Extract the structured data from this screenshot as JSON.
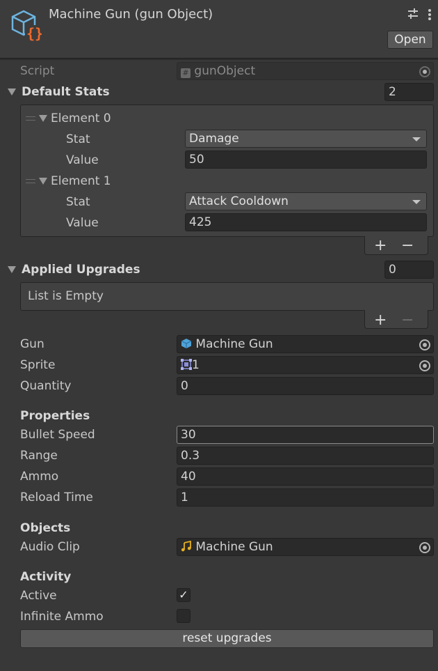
{
  "header": {
    "title": "Machine Gun (gun Object)",
    "open_label": "Open",
    "icon": "scriptable-object-icon",
    "menu_icons": [
      "settings-sliders-icon",
      "kebab-menu-icon"
    ]
  },
  "script": {
    "label": "Script",
    "value": "gunObject",
    "icon": "csharp-script-icon"
  },
  "default_stats": {
    "label": "Default Stats",
    "count": "2",
    "elements": [
      {
        "label": "Element 0",
        "stat_label": "Stat",
        "stat_value": "Damage",
        "value_label": "Value",
        "value": "50"
      },
      {
        "label": "Element 1",
        "stat_label": "Stat",
        "stat_value": "Attack Cooldown",
        "value_label": "Value",
        "value": "425"
      }
    ],
    "add": "+",
    "remove": "−"
  },
  "applied_upgrades": {
    "label": "Applied Upgrades",
    "count": "0",
    "empty_text": "List is Empty",
    "add": "+",
    "remove": "−"
  },
  "fields": {
    "gun": {
      "label": "Gun",
      "value": "Machine Gun",
      "icon": "cube-icon"
    },
    "sprite": {
      "label": "Sprite",
      "value": "1",
      "icon": "sprite-icon"
    },
    "quantity": {
      "label": "Quantity",
      "value": "0"
    }
  },
  "properties": {
    "header": "Properties",
    "bullet_speed": {
      "label": "Bullet Speed",
      "value": "30"
    },
    "range": {
      "label": "Range",
      "value": "0.3"
    },
    "ammo": {
      "label": "Ammo",
      "value": "40"
    },
    "reload_time": {
      "label": "Reload Time",
      "value": "1"
    }
  },
  "objects": {
    "header": "Objects",
    "audio_clip": {
      "label": "Audio Clip",
      "value": "Machine Gun",
      "icon": "audio-clip-icon"
    }
  },
  "activity": {
    "header": "Activity",
    "active": {
      "label": "Active",
      "checked": true,
      "check_glyph": "✓"
    },
    "infinite_ammo": {
      "label": "Infinite Ammo",
      "checked": false
    }
  },
  "reset_button": "reset upgrades",
  "colors": {
    "background": "#383838",
    "field": "#2a2a2a",
    "accent_icon": "#4fa3d8",
    "orange": "#f06a2c",
    "audio": "#e6b020"
  }
}
